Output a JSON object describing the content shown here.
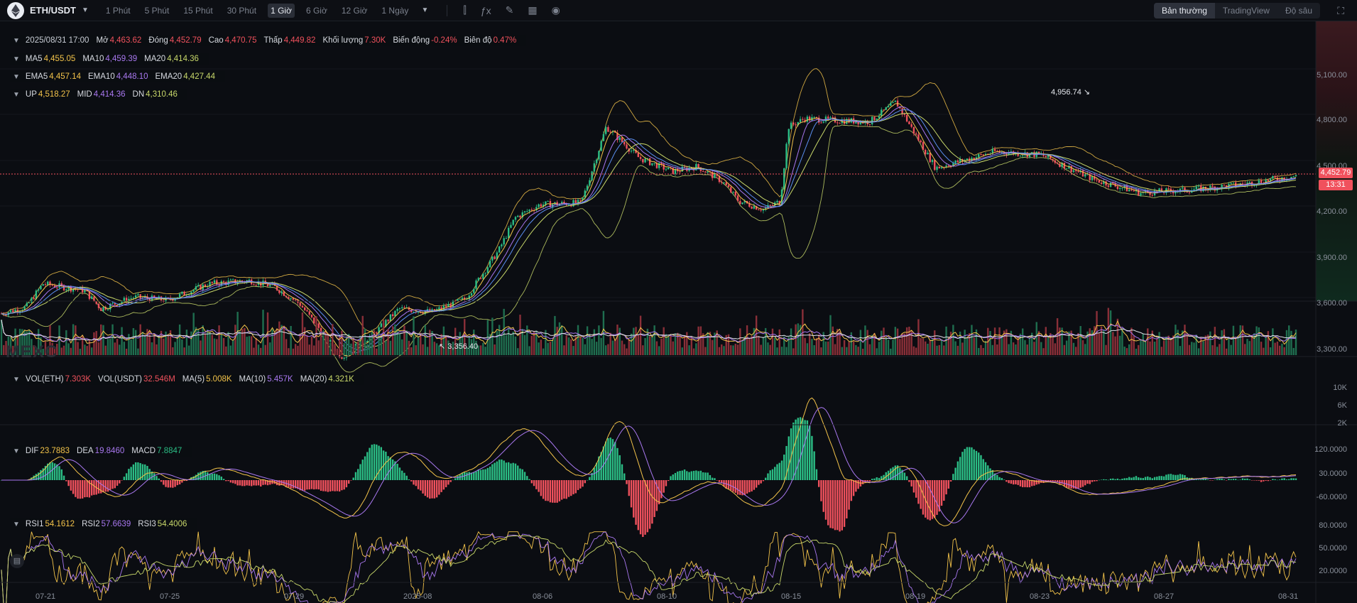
{
  "header": {
    "symbol": "ETH/USDT",
    "timeframes": [
      "1 Phút",
      "5 Phút",
      "15 Phút",
      "30 Phút",
      "1 Giờ",
      "6 Giờ",
      "12 Giờ",
      "1 Ngày"
    ],
    "active_timeframe": "1 Giờ",
    "tool_icons": [
      "candle-type-icon",
      "indicator-icon",
      "draw-icon",
      "layout-icon",
      "camera-icon"
    ],
    "views": [
      "Bản thường",
      "TradingView",
      "Độ sâu"
    ],
    "active_view": "Bản thường"
  },
  "ohlc": {
    "date": "2025/08/31 17:00",
    "open_label": "Mở",
    "open": "4,463.62",
    "close_label": "Đóng",
    "close": "4,452.79",
    "high_label": "Cao",
    "high": "4,470.75",
    "low_label": "Thấp",
    "low": "4,449.82",
    "volume_label": "Khối lượng",
    "volume": "7.30K",
    "change_label": "Biến động",
    "change": "-0.24%",
    "amplitude_label": "Biên độ",
    "amplitude": "0.47%"
  },
  "ma": {
    "ma5_label": "MA5",
    "ma5": "4,455.05",
    "ma10_label": "MA10",
    "ma10": "4,459.39",
    "ma20_label": "MA20",
    "ma20": "4,414.36"
  },
  "ema": {
    "ema5_label": "EMA5",
    "ema5": "4,457.14",
    "ema10_label": "EMA10",
    "ema10": "4,448.10",
    "ema20_label": "EMA20",
    "ema20": "4,427.44"
  },
  "boll": {
    "up_label": "UP",
    "up": "4,518.27",
    "mid_label": "MID",
    "mid": "4,414.36",
    "dn_label": "DN",
    "dn": "4,310.46"
  },
  "vol": {
    "eth_label": "VOL(ETH)",
    "eth": "7.303K",
    "usdt_label": "VOL(USDT)",
    "usdt": "32.546M",
    "ma5_label": "MA(5)",
    "ma5": "5.008K",
    "ma10_label": "MA(10)",
    "ma10": "5.457K",
    "ma20_label": "MA(20)",
    "ma20": "4.321K"
  },
  "macd": {
    "dif_label": "DIF",
    "dif": "23.7883",
    "dea_label": "DEA",
    "dea": "19.8460",
    "macd_label": "MACD",
    "macd": "7.8847"
  },
  "rsi": {
    "rsi1_label": "RSI1",
    "rsi1": "54.1612",
    "rsi2_label": "RSI2",
    "rsi2": "57.6639",
    "rsi3_label": "RSI3",
    "rsi3": "54.4006"
  },
  "price_axis": [
    "5,100.00",
    "4,800.00",
    "4,500.00",
    "4,200.00",
    "3,900.00",
    "3,600.00",
    "3,300.00"
  ],
  "vol_axis": [
    "10K",
    "6K",
    "2K"
  ],
  "macd_axis": [
    "120.0000",
    "30.0000",
    "-60.0000"
  ],
  "rsi_axis": [
    "80.0000",
    "50.0000",
    "20.0000"
  ],
  "date_axis": [
    "07-21",
    "07-25",
    "07-29",
    "2025-08",
    "08-06",
    "08-10",
    "08-15",
    "08-19",
    "08-23",
    "08-27",
    "08-31"
  ],
  "last_price": "4,452.79",
  "countdown": "13:31",
  "high_mark": "4,956.74",
  "low_mark": "3,356.40",
  "watermark": "MEXC",
  "colors": {
    "up": "#2bbd85",
    "down": "#f0515d",
    "ma5": "#f3c34a",
    "ma10": "#a978f0",
    "ma20": "#c8d86a",
    "bg": "#0b0d12"
  }
}
